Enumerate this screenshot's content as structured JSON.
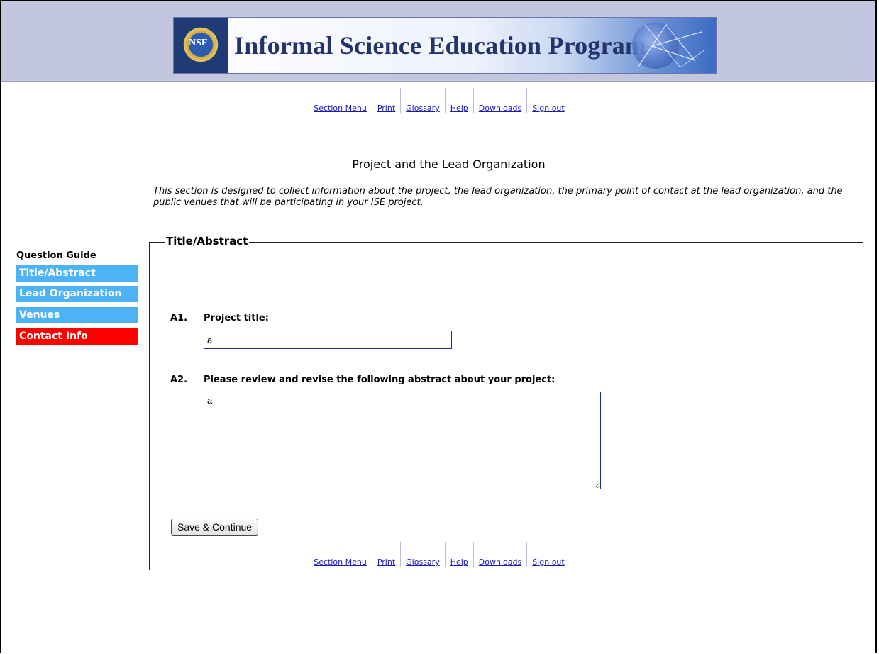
{
  "banner": {
    "seal_text": "NSF",
    "title": "Informal Science Education Program"
  },
  "nav": {
    "items": [
      "Section Menu",
      "Print",
      "Glossary",
      "Help",
      "Downloads",
      "Sign out"
    ]
  },
  "page": {
    "title": "Project and the Lead Organization",
    "intro": "This section is designed to collect information about the project, the lead organization, the primary point of contact at the lead organization, and the public venues that will be participating in your ISE project."
  },
  "guide": {
    "heading": "Question Guide",
    "items": [
      {
        "label": "Title/Abstract",
        "color": "#4db3f5"
      },
      {
        "label": "Lead Organization",
        "color": "#4db3f5"
      },
      {
        "label": "Venues",
        "color": "#4db3f5"
      },
      {
        "label": "Contact Info",
        "color": "#ff0000"
      }
    ]
  },
  "form": {
    "legend": "Title/Abstract",
    "q1": {
      "num": "A1.",
      "label": "Project title:",
      "value": "a"
    },
    "q2": {
      "num": "A2.",
      "label": "Please review and revise the following abstract about your project:",
      "value": "a"
    },
    "submit": "Save & Continue"
  }
}
